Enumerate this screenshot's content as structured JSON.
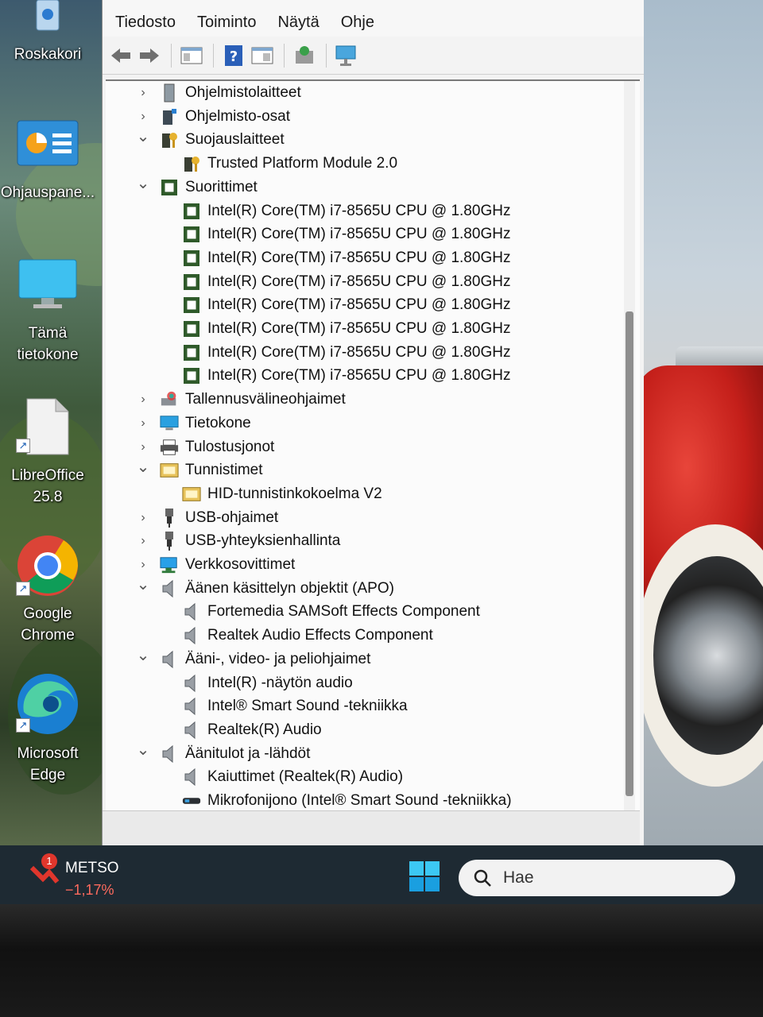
{
  "desktop": {
    "icons": [
      {
        "label": "Roskakori"
      },
      {
        "label": "Ohjauspane..."
      },
      {
        "label": "Tämä tietokone"
      },
      {
        "label": "LibreOffice 25.8"
      },
      {
        "label": "Google Chrome"
      },
      {
        "label": "Microsoft Edge"
      }
    ]
  },
  "window": {
    "menu": [
      "Tiedosto",
      "Toiminto",
      "Näytä",
      "Ohje"
    ],
    "tree": [
      {
        "label": "Ohjelmistolaitteet",
        "level": 0,
        "expanded": false,
        "icon": "software-device-icon"
      },
      {
        "label": "Ohjelmisto-osat",
        "level": 0,
        "expanded": false,
        "icon": "software-component-icon"
      },
      {
        "label": "Suojauslaitteet",
        "level": 0,
        "expanded": true,
        "icon": "security-device-icon"
      },
      {
        "label": "Trusted Platform Module 2.0",
        "level": 1,
        "icon": "security-device-icon"
      },
      {
        "label": "Suorittimet",
        "level": 0,
        "expanded": true,
        "icon": "processor-icon"
      },
      {
        "label": "Intel(R) Core(TM) i7-8565U CPU @ 1.80GHz",
        "level": 1,
        "icon": "processor-icon"
      },
      {
        "label": "Intel(R) Core(TM) i7-8565U CPU @ 1.80GHz",
        "level": 1,
        "icon": "processor-icon"
      },
      {
        "label": "Intel(R) Core(TM) i7-8565U CPU @ 1.80GHz",
        "level": 1,
        "icon": "processor-icon"
      },
      {
        "label": "Intel(R) Core(TM) i7-8565U CPU @ 1.80GHz",
        "level": 1,
        "icon": "processor-icon"
      },
      {
        "label": "Intel(R) Core(TM) i7-8565U CPU @ 1.80GHz",
        "level": 1,
        "icon": "processor-icon"
      },
      {
        "label": "Intel(R) Core(TM) i7-8565U CPU @ 1.80GHz",
        "level": 1,
        "icon": "processor-icon"
      },
      {
        "label": "Intel(R) Core(TM) i7-8565U CPU @ 1.80GHz",
        "level": 1,
        "icon": "processor-icon"
      },
      {
        "label": "Intel(R) Core(TM) i7-8565U CPU @ 1.80GHz",
        "level": 1,
        "icon": "processor-icon"
      },
      {
        "label": "Tallennusvälineohjaimet",
        "level": 0,
        "expanded": false,
        "icon": "storage-controller-icon"
      },
      {
        "label": "Tietokone",
        "level": 0,
        "expanded": false,
        "icon": "computer-icon"
      },
      {
        "label": "Tulostusjonot",
        "level": 0,
        "expanded": false,
        "icon": "printer-icon"
      },
      {
        "label": "Tunnistimet",
        "level": 0,
        "expanded": true,
        "icon": "sensor-icon"
      },
      {
        "label": "HID-tunnistinkokoelma V2",
        "level": 1,
        "icon": "sensor-icon"
      },
      {
        "label": "USB-ohjaimet",
        "level": 0,
        "expanded": false,
        "icon": "usb-icon"
      },
      {
        "label": "USB-yhteyksienhallinta",
        "level": 0,
        "expanded": false,
        "icon": "usb-icon"
      },
      {
        "label": "Verkkosovittimet",
        "level": 0,
        "expanded": false,
        "icon": "network-adapter-icon"
      },
      {
        "label": "Äänen käsittelyn objektit (APO)",
        "level": 0,
        "expanded": true,
        "icon": "speaker-icon"
      },
      {
        "label": "Fortemedia SAMSoft Effects Component",
        "level": 1,
        "icon": "speaker-icon"
      },
      {
        "label": "Realtek Audio Effects Component",
        "level": 1,
        "icon": "speaker-icon"
      },
      {
        "label": "Ääni-, video- ja peliohjaimet",
        "level": 0,
        "expanded": true,
        "icon": "speaker-icon"
      },
      {
        "label": "Intel(R) -näytön audio",
        "level": 1,
        "icon": "speaker-icon"
      },
      {
        "label": "Intel® Smart Sound -tekniikka",
        "level": 1,
        "icon": "speaker-icon"
      },
      {
        "label": "Realtek(R) Audio",
        "level": 1,
        "icon": "speaker-icon"
      },
      {
        "label": "Äänitulot ja -lähdöt",
        "level": 0,
        "expanded": true,
        "icon": "speaker-icon"
      },
      {
        "label": "Kaiuttimet (Realtek(R) Audio)",
        "level": 1,
        "icon": "speaker-icon"
      },
      {
        "label": "Mikrofonijono (Intel® Smart Sound -tekniikka)",
        "level": 1,
        "icon": "microphone-icon"
      }
    ]
  },
  "taskbar": {
    "stock_name": "METSO",
    "stock_change": "−1,17%",
    "stock_badge": "1",
    "search_placeholder": "Hae"
  }
}
